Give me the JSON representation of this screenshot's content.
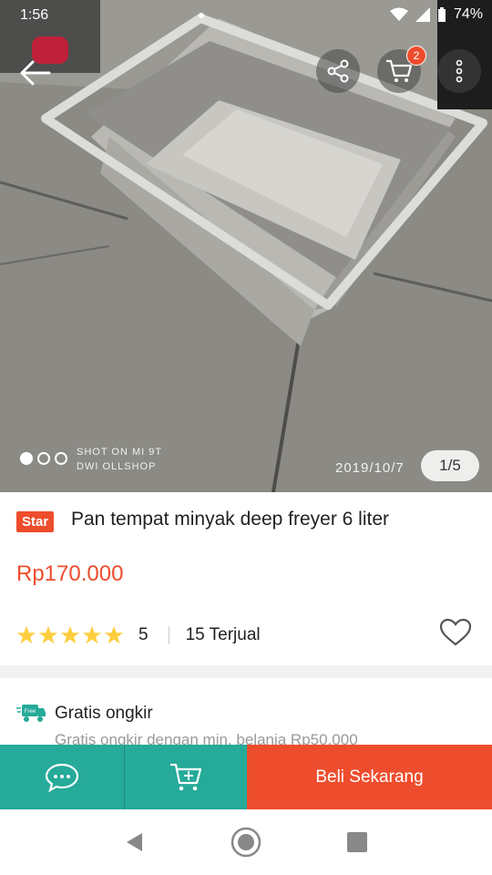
{
  "status_bar": {
    "time": "1:56",
    "battery": "74%"
  },
  "top_bar": {
    "cart_count": "2"
  },
  "gallery": {
    "watermark_line1": "SHOT ON MI 9T",
    "watermark_line2": "DWI OLLSHOP",
    "date_stamp": "2019/10/7",
    "counter": "1/5",
    "dots_total": 3,
    "dots_active": 1
  },
  "product": {
    "badge": "Star",
    "title": "Pan tempat minyak deep freyer 6 liter",
    "price": "Rp170.000",
    "rating": "5",
    "stars": 5,
    "sold": "15 Terjual"
  },
  "shipping": {
    "icon_label": "Free",
    "title": "Gratis ongkir",
    "subtitle": "Gratis ongkir dengan min. belanja Rp50.000"
  },
  "actions": {
    "buy_label": "Beli Sekarang"
  },
  "colors": {
    "accent": "#ee4d2d",
    "teal": "#26aa99",
    "star": "#ffce3d"
  }
}
